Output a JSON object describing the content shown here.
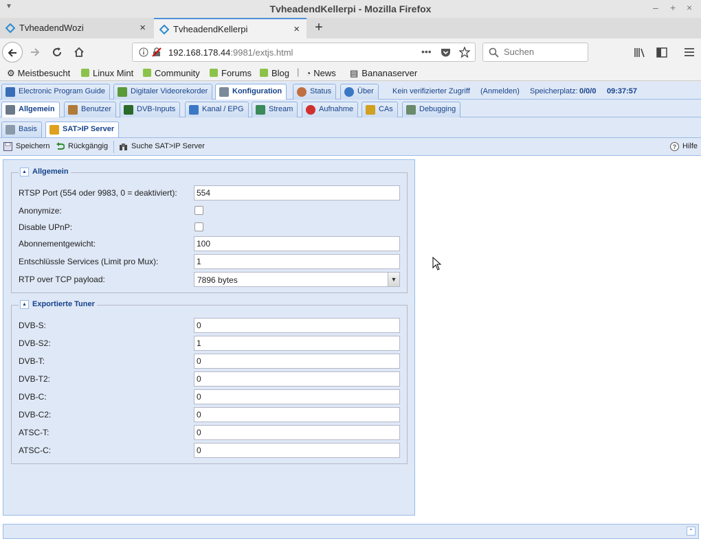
{
  "window": {
    "title": "TvheadendKellerpi - Mozilla Firefox",
    "menu_icon": "chevron-down-icon",
    "controls": [
      "–",
      "+",
      "×"
    ]
  },
  "browser_tabs": [
    {
      "label": "TvheadendWozi",
      "close": "×"
    },
    {
      "label": "TvheadendKellerpi",
      "close": "×"
    }
  ],
  "new_tab_label": "+",
  "address": {
    "host": "192.168.178.44",
    "rest": ":9981/extjs.html",
    "more": "•••"
  },
  "search": {
    "placeholder": "Suchen"
  },
  "bookmarks": [
    "Meistbesucht",
    "Linux Mint",
    "Community",
    "Forums",
    "Blog",
    "News",
    "Bananaserver"
  ],
  "main_tabs": [
    {
      "label": "Electronic Program Guide",
      "color": "#3a6db5"
    },
    {
      "label": "Digitaler Videorekorder",
      "color": "#5a9a3a"
    },
    {
      "label": "Konfiguration",
      "color": "#7a8a9a"
    },
    {
      "label": "Status",
      "color": "#c07040"
    },
    {
      "label": "Über",
      "color": "#3a78c5"
    }
  ],
  "header_info": {
    "access": "Kein verifizierter Zugriff",
    "login": "(Anmelden)",
    "storage_label": "Speicherplatz:",
    "storage_value": "0/0/0",
    "time": "09:37:57"
  },
  "config_tabs": [
    {
      "label": "Allgemein",
      "color": "#6a7a8a"
    },
    {
      "label": "Benutzer",
      "color": "#b07a3a"
    },
    {
      "label": "DVB-Inputs",
      "color": "#2a6a2a"
    },
    {
      "label": "Kanal / EPG",
      "color": "#3a78c5"
    },
    {
      "label": "Stream",
      "color": "#3a8a5a"
    },
    {
      "label": "Aufnahme",
      "color": "#d03030"
    },
    {
      "label": "CAs",
      "color": "#d0a020"
    },
    {
      "label": "Debugging",
      "color": "#6a8a6a"
    }
  ],
  "sub_tabs": [
    {
      "label": "Basis",
      "color": "#8a9aaa"
    },
    {
      "label": "SAT>IP Server",
      "color": "#e0a020"
    }
  ],
  "toolbar": {
    "save": "Speichern",
    "undo": "Rückgängig",
    "discover": "Suche SAT>IP Server",
    "help": "Hilfe"
  },
  "general_section": {
    "legend": "Allgemein",
    "rtsp_label": "RTSP Port (554 oder 9983, 0 = deaktiviert):",
    "rtsp_value": "554",
    "anonymize_label": "Anonymize:",
    "anonymize_checked": false,
    "upnp_label": "Disable UPnP:",
    "upnp_checked": false,
    "weight_label": "Abonnementgewicht:",
    "weight_value": "100",
    "descramble_label": "Entschlüssle Services (Limit pro Mux):",
    "descramble_value": "1",
    "rtp_label": "RTP over TCP payload:",
    "rtp_value": "7896 bytes"
  },
  "tuner_section": {
    "legend": "Exportierte Tuner",
    "tuners": [
      {
        "label": "DVB-S:",
        "value": "0"
      },
      {
        "label": "DVB-S2:",
        "value": "1"
      },
      {
        "label": "DVB-T:",
        "value": "0"
      },
      {
        "label": "DVB-T2:",
        "value": "0"
      },
      {
        "label": "DVB-C:",
        "value": "0"
      },
      {
        "label": "DVB-C2:",
        "value": "0"
      },
      {
        "label": "ATSC-T:",
        "value": "0"
      },
      {
        "label": "ATSC-C:",
        "value": "0"
      }
    ]
  },
  "colors": {
    "ext_blue": "#15428b",
    "panel_bg": "#dfe8f6",
    "panel_border": "#99bbe8",
    "firefox_accent": "#4a90d9"
  }
}
